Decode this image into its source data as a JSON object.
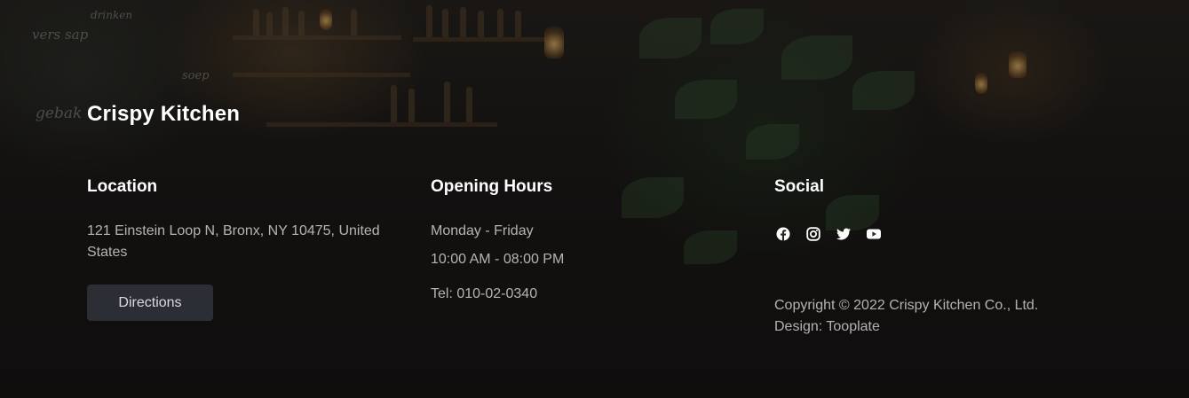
{
  "brand": {
    "name": "Crispy Kitchen"
  },
  "location": {
    "heading": "Location",
    "address": "121 Einstein Loop N, Bronx, NY 10475, United States",
    "directions_label": "Directions"
  },
  "hours": {
    "heading": "Opening Hours",
    "days": "Monday - Friday",
    "time": "10:00 AM - 08:00 PM",
    "tel": "Tel: 010-02-0340"
  },
  "social": {
    "heading": "Social",
    "icons": [
      "facebook-icon",
      "instagram-icon",
      "twitter-icon",
      "youtube-icon"
    ],
    "copyright": "Copyright © 2022 Crispy Kitchen Co., Ltd.",
    "design": "Design: Tooplate"
  },
  "background": {
    "chalk_lines": [
      "drinken",
      "vers sap",
      "soep",
      "gebak"
    ]
  },
  "colors": {
    "heading": "#ffffff",
    "text": "#c8c8c8",
    "button_bg": "#2b2e35"
  }
}
